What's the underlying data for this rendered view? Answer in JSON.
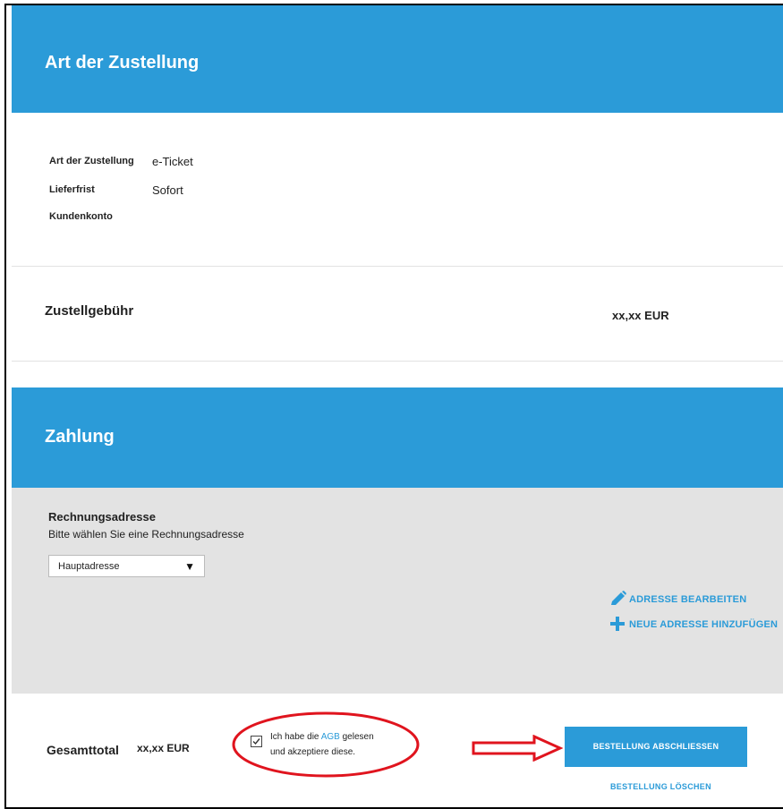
{
  "delivery": {
    "title": "Art der Zustellung",
    "rows": [
      {
        "label": "Art der Zustellung",
        "value": "e-Ticket"
      },
      {
        "label": "Lieferfrist",
        "value": "Sofort"
      },
      {
        "label": "Kundenkonto",
        "value": ""
      }
    ],
    "fee_label": "Zustellgebühr",
    "fee_value": "xx,xx EUR"
  },
  "payment": {
    "title": "Zahlung",
    "billing_title": "Rechnungsadresse",
    "billing_hint": "Bitte wählen Sie eine Rechnungsadresse",
    "address_select": "Hauptadresse",
    "edit_address": "ADRESSE BEARBEITEN",
    "add_address": "NEUE ADRESSE HINZUFÜGEN"
  },
  "total": {
    "label": "Gesamttotal",
    "value": "xx,xx EUR",
    "agb_prefix": "Ich habe die ",
    "agb_link": "AGB",
    "agb_suffix": " gelesen",
    "agb_line2": "und akzeptiere diese.",
    "submit_button": "BESTELLUNG ABSCHLIESSEN",
    "delete_link": "BESTELLUNG LÖSCHEN"
  },
  "colors": {
    "accent": "#2b9bd8",
    "annotation": "#e0141e",
    "panel": "#e3e3e3"
  }
}
